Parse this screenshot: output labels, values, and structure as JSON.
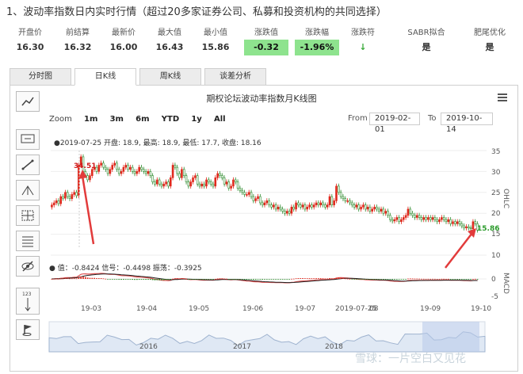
{
  "heading": "1、波动率指数日内实时行情（超过20多家证券公司、私募和投资机构的共同选择）",
  "stats": [
    {
      "label": "开盘价",
      "value": "16.30",
      "highlight": false
    },
    {
      "label": "前结算",
      "value": "16.32",
      "highlight": false
    },
    {
      "label": "最新价",
      "value": "16.00",
      "highlight": false
    },
    {
      "label": "最大值",
      "value": "16.43",
      "highlight": false
    },
    {
      "label": "最小值",
      "value": "15.86",
      "highlight": false
    },
    {
      "label": "涨跌值",
      "value": "-0.32",
      "highlight": true
    },
    {
      "label": "涨跌幅",
      "value": "-1.96%",
      "highlight": true
    },
    {
      "label": "涨跌符",
      "value": "↓",
      "highlight": false
    },
    {
      "label": "SABR拟合",
      "value": "是",
      "highlight": false
    },
    {
      "label": "肥尾优化",
      "value": "是",
      "highlight": false
    }
  ],
  "tabs": [
    "分时图",
    "日K线",
    "周K线",
    "谈差分析"
  ],
  "active_tab": 1,
  "chart": {
    "title": "期权论坛波动率指数月K线图",
    "zoom_label": "Zoom",
    "zoom_buttons": [
      "1m",
      "3m",
      "6m",
      "YTD",
      "1y",
      "All"
    ],
    "from_label": "From",
    "from_date": "2019-02-01",
    "to_label": "To",
    "to_date": "2019-10-14",
    "info": "●2019-07-25 开盘: 18.9, 最高: 18.9, 最低: 17.7, 收盘: 18.16",
    "macd_info": "● 值：-0.8424 信号：-0.4498 振荡：-0.3925",
    "price_axis_label": "OHLC",
    "macd_axis_label": "MACD",
    "price_ticks": [
      "35",
      "30",
      "25",
      "20",
      "15",
      "10"
    ],
    "macd_ticks": [
      "0",
      "-5"
    ],
    "x_ticks": [
      "19-03",
      "19-04",
      "19-05",
      "19-06",
      "19-07",
      "2019-07-25",
      "08",
      "19-09",
      "19-10"
    ],
    "nav_ticks": [
      "2016",
      "2017",
      "2018"
    ],
    "high_mark": "34.51",
    "last_mark": "15.86"
  },
  "tools": [
    "trend-lines-icon",
    "text-annotation-icon",
    "line-icon",
    "pitchfork-icon",
    "crosshair-icon",
    "grid-lines-icon",
    "hide-icon",
    "vertical-counter-icon",
    "flag-icon"
  ],
  "watermark": "雪球：一片空白又见花",
  "chart_data": {
    "type": "candlestick",
    "title": "期权论坛波动率指数月K线图",
    "x_range": [
      "2019-02-01",
      "2019-10-14"
    ],
    "y_range": [
      10,
      35
    ],
    "ylabel": "OHLC",
    "highlight": {
      "date": "2019-07-25",
      "open": 18.9,
      "high": 18.9,
      "low": 17.7,
      "close": 18.16
    },
    "annotations": [
      {
        "label": "34.51",
        "type": "max"
      },
      {
        "label": "15.86",
        "type": "last"
      }
    ],
    "close": [
      22.0,
      22.5,
      23.0,
      22.3,
      24.0,
      23.6,
      25.0,
      24.0,
      23.5,
      24.5,
      25.0,
      24.2,
      31.5,
      33.5,
      30.0,
      29.0,
      28.0,
      29.0,
      30.5,
      31.0,
      30.0,
      31.5,
      32.0,
      31.0,
      30.5,
      29.5,
      30.5,
      31.5,
      32.0,
      30.5,
      29.5,
      30.0,
      31.0,
      31.5,
      30.5,
      31.0,
      30.0,
      29.5,
      30.0,
      31.0,
      30.5,
      30.0,
      29.5,
      30.0,
      29.0,
      27.5,
      27.0,
      28.0,
      27.0,
      26.5,
      27.0,
      27.5,
      26.5,
      28.5,
      31.5,
      31.0,
      29.5,
      28.5,
      30.5,
      29.0,
      27.5,
      26.5,
      27.5,
      28.5,
      29.0,
      27.0,
      26.5,
      27.0,
      26.5,
      28.0,
      27.5,
      27.0,
      26.5,
      28.5,
      29.5,
      29.0,
      28.5,
      27.0,
      27.5,
      26.0,
      26.5,
      28.0,
      27.5,
      26.0,
      25.5,
      25.0,
      24.5,
      24.5,
      25.0,
      24.0,
      23.0,
      23.5,
      24.0,
      22.5,
      22.0,
      22.5,
      23.0,
      22.0,
      21.5,
      22.0,
      21.0,
      21.5,
      21.0,
      20.5,
      20.0,
      20.5,
      20.0,
      21.5,
      21.0,
      22.5,
      22.0,
      21.5,
      22.0,
      21.0,
      21.5,
      22.0,
      21.5,
      22.0,
      22.5,
      22.0,
      22.5,
      22.0,
      21.5,
      22.0,
      24.0,
      22.0,
      23.0,
      26.5,
      25.0,
      24.0,
      23.5,
      23.0,
      23.0,
      22.5,
      22.0,
      21.5,
      22.0,
      21.0,
      21.5,
      22.0,
      21.0,
      21.5,
      20.5,
      21.0,
      21.5,
      21.0,
      20.5,
      21.0,
      20.0,
      20.5,
      19.5,
      18.5,
      18.16,
      18.5,
      19.0,
      18.0,
      18.5,
      19.0,
      19.5,
      21.0,
      20.0,
      19.5,
      19.0,
      19.5,
      19.0,
      18.5,
      19.0,
      18.5,
      19.0,
      18.5,
      19.0,
      18.5,
      18.0,
      18.5,
      19.0,
      18.5,
      18.0,
      18.5,
      17.5,
      18.0,
      17.5,
      18.0,
      17.5,
      17.0,
      16.5,
      16.8,
      16.5,
      16.3,
      18.0,
      17.5,
      16.0
    ]
  }
}
